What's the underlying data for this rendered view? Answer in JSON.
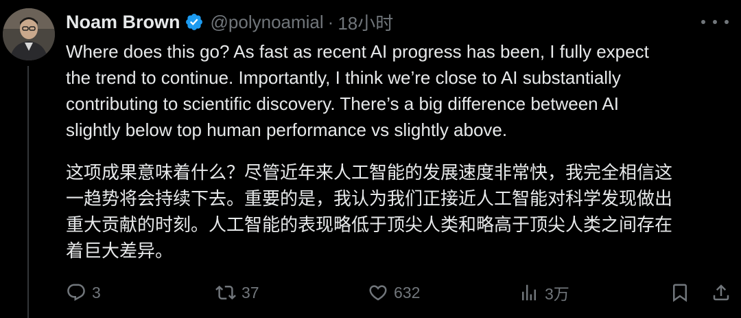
{
  "author": {
    "name": "Noam Brown",
    "handle": "@polynoamial",
    "separator": "·",
    "time": "18小时"
  },
  "tweet": {
    "paragraphs": [
      "Where does this go? As fast as recent AI progress has been, I fully expect\nthe trend to continue. Importantly, I think we’re close to AI substantially\ncontributing to scientific discovery. There’s a big difference between AI\nslightly below top human performance vs slightly above.",
      "这项成果意味着什么？尽管近年来人工智能的发展速度非常快，我完全相信这\n一趋势将会持续下去。重要的是，我认为我们正接近人工智能对科学发现做出\n重大贡献的时刻。人工智能的表现略低于顶尖人类和略高于顶尖人类之间存在\n着巨大差异。"
    ]
  },
  "actions": {
    "reply": {
      "icon": "reply-icon",
      "count": "3"
    },
    "retweet": {
      "icon": "retweet-icon",
      "count": "37"
    },
    "like": {
      "icon": "heart-icon",
      "count": "632"
    },
    "views": {
      "icon": "views-icon",
      "count": "3万"
    },
    "bookmark": {
      "icon": "bookmark-icon"
    },
    "share": {
      "icon": "share-icon"
    }
  },
  "colors": {
    "background": "#000000",
    "text": "#e7e9ea",
    "secondary": "#71767b",
    "verified": "#1d9bf0"
  }
}
